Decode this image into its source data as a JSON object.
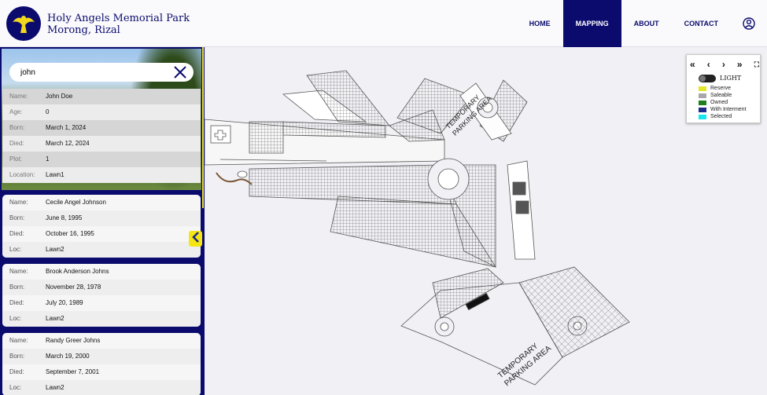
{
  "brand": {
    "line1": "Holy Angels Memorial Park",
    "line2": "Morong, Rizal"
  },
  "nav": [
    {
      "label": "HOME",
      "active": false
    },
    {
      "label": "MAPPING",
      "active": true
    },
    {
      "label": "ABOUT",
      "active": false
    },
    {
      "label": "CONTACT",
      "active": false
    }
  ],
  "search": {
    "value": "john"
  },
  "results": [
    {
      "rows": [
        {
          "k": "Name:",
          "v": "John Doe"
        },
        {
          "k": "Age:",
          "v": "0"
        },
        {
          "k": "Born:",
          "v": "March 1, 2024"
        },
        {
          "k": "Died:",
          "v": "March 12, 2024"
        },
        {
          "k": "Plot:",
          "v": "1"
        },
        {
          "k": "Location:",
          "v": "Lawn1"
        }
      ]
    },
    {
      "rows": [
        {
          "k": "Name:",
          "v": "Cecile Angel Johnson"
        },
        {
          "k": "Born:",
          "v": "June 8, 1995"
        },
        {
          "k": "Died:",
          "v": "October 16, 1995"
        },
        {
          "k": "Loc:",
          "v": "Lawn2"
        }
      ]
    },
    {
      "rows": [
        {
          "k": "Name:",
          "v": "Brook Anderson Johns"
        },
        {
          "k": "Born:",
          "v": "November 28, 1978"
        },
        {
          "k": "Died:",
          "v": "July 20, 1989"
        },
        {
          "k": "Loc:",
          "v": "Lawn2"
        }
      ]
    },
    {
      "rows": [
        {
          "k": "Name:",
          "v": "Randy Greer Johns"
        },
        {
          "k": "Born:",
          "v": "March 19, 2000"
        },
        {
          "k": "Died:",
          "v": "September 7, 2001"
        },
        {
          "k": "Loc:",
          "v": "Lawn2"
        }
      ]
    }
  ],
  "map": {
    "labels": [
      "TEMPORARY",
      "PARKING AREA"
    ]
  },
  "legend": {
    "controls": [
      "«",
      "‹",
      "›",
      "»",
      "⛶"
    ],
    "toggle_label": "LIGHT",
    "items": [
      {
        "label": "Reserve",
        "color": "#e6e62a"
      },
      {
        "label": "Saleable",
        "color": "#a8a8a8"
      },
      {
        "label": "Owned",
        "color": "#1e7f1e"
      },
      {
        "label": "With Interment",
        "color": "#1c2a8a"
      },
      {
        "label": "Selected",
        "color": "#18e6ee"
      }
    ]
  },
  "icons": {
    "logo": "angel-logo-icon",
    "user": "user-circle-icon",
    "clear": "close-icon",
    "collapse": "chevron-left-icon"
  }
}
